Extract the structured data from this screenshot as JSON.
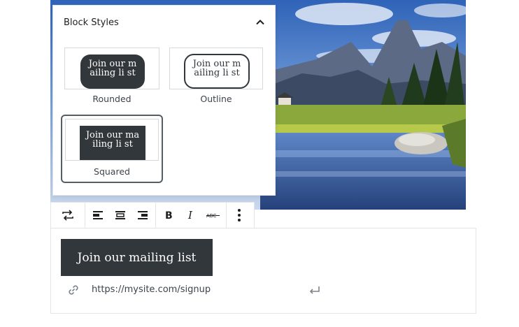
{
  "popover": {
    "title": "Block Styles",
    "options": [
      {
        "label": "Rounded",
        "preview_text": "Join our mailing li st",
        "selected": false
      },
      {
        "label": "Outline",
        "preview_text": "Join our mailing li st",
        "selected": false
      },
      {
        "label": "Squared",
        "preview_text": "Join our mailing li st",
        "selected": true
      }
    ]
  },
  "toolbar": {
    "buttons": [
      "change-block-type",
      "align-left",
      "align-center",
      "align-right",
      "bold",
      "italic",
      "strikethrough",
      "more-options"
    ]
  },
  "block": {
    "button_text": "Join our mailing list",
    "url_value": "https://mysite.com/signup"
  },
  "colors": {
    "button_bg": "#32373c",
    "border": "#e2e4e7",
    "selected_border": "#555d66"
  }
}
